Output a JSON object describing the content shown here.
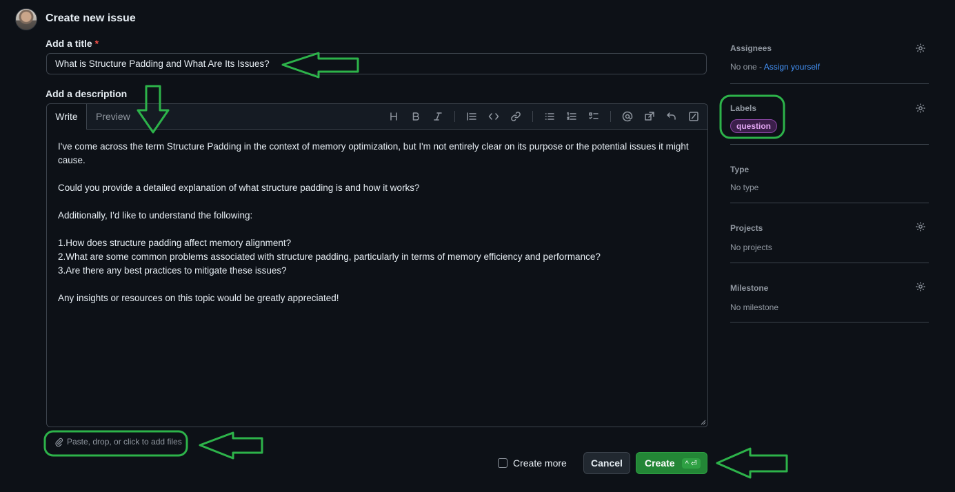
{
  "header": {
    "title": "Create new issue"
  },
  "title_field": {
    "label": "Add a title",
    "required_mark": "*",
    "value": "What is Structure Padding and What Are Its Issues?"
  },
  "description": {
    "label": "Add a description",
    "tabs": {
      "write": "Write",
      "preview": "Preview"
    },
    "toolbar": [
      "heading-icon",
      "bold-icon",
      "italic-icon",
      "quote-icon",
      "code-icon",
      "link-icon",
      "unordered-list-icon",
      "ordered-list-icon",
      "task-list-icon",
      "mention-icon",
      "reference-icon",
      "undo-icon",
      "slash-command-icon"
    ],
    "paragraphs": [
      "I've come across the term Structure Padding in the context of memory optimization, but I'm not entirely clear on its purpose or the potential issues it might cause.",
      "Could you provide a detailed explanation of what structure padding is and how it works?",
      "Additionally, I'd like to understand the following:",
      "1.How does structure padding affect memory alignment?",
      "2.What are some common problems associated with structure padding, particularly in terms of memory efficiency and performance?",
      "3.Are there any best practices to mitigate these issues?",
      "Any insights or resources on this topic would be greatly appreciated!"
    ],
    "attach_text": "Paste, drop, or click to add files"
  },
  "footer": {
    "create_more": "Create more",
    "cancel": "Cancel",
    "create": "Create",
    "create_shortcut": "^ ⏎"
  },
  "sidebar": {
    "assignees": {
      "title": "Assignees",
      "value": "No one - ",
      "link": "Assign yourself"
    },
    "labels": {
      "title": "Labels",
      "items": [
        "question"
      ]
    },
    "type": {
      "title": "Type",
      "value": "No type"
    },
    "projects": {
      "title": "Projects",
      "value": "No projects"
    },
    "milestone": {
      "title": "Milestone",
      "value": "No milestone"
    }
  },
  "colors": {
    "accent_green": "#238636",
    "link_blue": "#4493f8",
    "annotation_green": "#2db34a",
    "label_purple": "#e2a6f2"
  }
}
